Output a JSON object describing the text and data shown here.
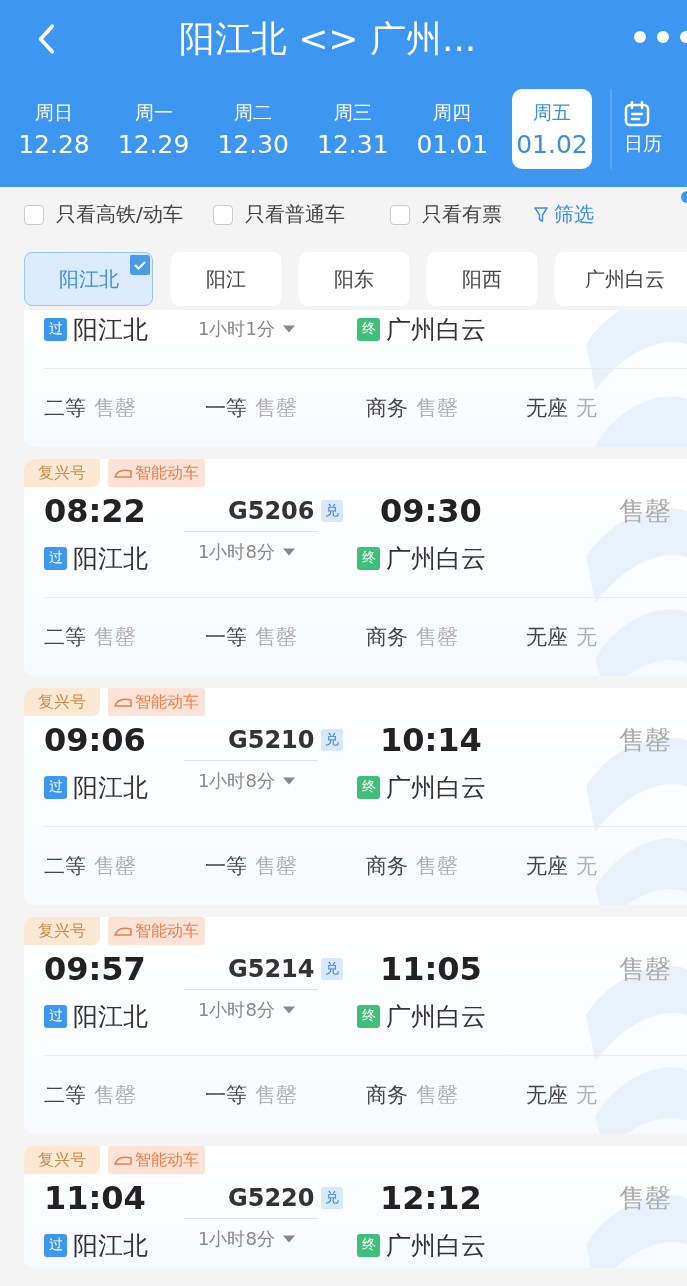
{
  "header": {
    "title": "阳江北 <> 广州..."
  },
  "dates": [
    {
      "weekday": "周日",
      "date": "12.28",
      "selected": false
    },
    {
      "weekday": "周一",
      "date": "12.29",
      "selected": false
    },
    {
      "weekday": "周二",
      "date": "12.30",
      "selected": false
    },
    {
      "weekday": "周三",
      "date": "12.31",
      "selected": false
    },
    {
      "weekday": "周四",
      "date": "01.01",
      "selected": false
    },
    {
      "weekday": "周五",
      "date": "01.02",
      "selected": true
    }
  ],
  "calendar": {
    "label": "日历"
  },
  "filters": [
    {
      "label": "只看高铁/动车",
      "checked": false
    },
    {
      "label": "只看普通车",
      "checked": false
    },
    {
      "label": "只看有票",
      "checked": false
    }
  ],
  "filter_button": {
    "label": "筛选"
  },
  "stations": [
    {
      "name": "阳江北",
      "selected": true
    },
    {
      "name": "阳江",
      "selected": false
    },
    {
      "name": "阳东",
      "selected": false
    },
    {
      "name": "阳西",
      "selected": false
    },
    {
      "name": "广州白云",
      "selected": false
    }
  ],
  "trains": [
    {
      "from_mark": "过",
      "from": "阳江北",
      "duration": "1小时1分",
      "to_mark": "终",
      "to": "广州白云",
      "seats": [
        {
          "class": "二等",
          "availability": "售罄"
        },
        {
          "class": "一等",
          "availability": "售罄"
        },
        {
          "class": "商务",
          "availability": "售罄"
        },
        {
          "class": "无座",
          "availability": "无"
        }
      ]
    },
    {
      "tags": [
        {
          "kind": "plain",
          "text": "复兴号"
        },
        {
          "kind": "smart",
          "text": "智能动车"
        }
      ],
      "depart": "08:22",
      "train_no": "G5206",
      "badge": "兑",
      "arrive": "09:30",
      "status": "售罄",
      "from_mark": "过",
      "from": "阳江北",
      "duration": "1小时8分",
      "to_mark": "终",
      "to": "广州白云",
      "seats": [
        {
          "class": "二等",
          "availability": "售罄"
        },
        {
          "class": "一等",
          "availability": "售罄"
        },
        {
          "class": "商务",
          "availability": "售罄"
        },
        {
          "class": "无座",
          "availability": "无"
        }
      ]
    },
    {
      "tags": [
        {
          "kind": "plain",
          "text": "复兴号"
        },
        {
          "kind": "smart",
          "text": "智能动车"
        }
      ],
      "depart": "09:06",
      "train_no": "G5210",
      "badge": "兑",
      "arrive": "10:14",
      "status": "售罄",
      "from_mark": "过",
      "from": "阳江北",
      "duration": "1小时8分",
      "to_mark": "终",
      "to": "广州白云",
      "seats": [
        {
          "class": "二等",
          "availability": "售罄"
        },
        {
          "class": "一等",
          "availability": "售罄"
        },
        {
          "class": "商务",
          "availability": "售罄"
        },
        {
          "class": "无座",
          "availability": "无"
        }
      ]
    },
    {
      "tags": [
        {
          "kind": "plain",
          "text": "复兴号"
        },
        {
          "kind": "smart",
          "text": "智能动车"
        }
      ],
      "depart": "09:57",
      "train_no": "G5214",
      "badge": "兑",
      "arrive": "11:05",
      "status": "售罄",
      "from_mark": "过",
      "from": "阳江北",
      "duration": "1小时8分",
      "to_mark": "终",
      "to": "广州白云",
      "seats": [
        {
          "class": "二等",
          "availability": "售罄"
        },
        {
          "class": "一等",
          "availability": "售罄"
        },
        {
          "class": "商务",
          "availability": "售罄"
        },
        {
          "class": "无座",
          "availability": "无"
        }
      ]
    },
    {
      "tags": [
        {
          "kind": "plain",
          "text": "复兴号"
        },
        {
          "kind": "smart",
          "text": "智能动车"
        }
      ],
      "depart": "11:04",
      "train_no": "G5220",
      "badge": "兑",
      "arrive": "12:12",
      "status": "售罄",
      "from_mark": "过",
      "from": "阳江北",
      "duration": "1小时8分",
      "to_mark": "终",
      "to": "广州白云"
    }
  ]
}
